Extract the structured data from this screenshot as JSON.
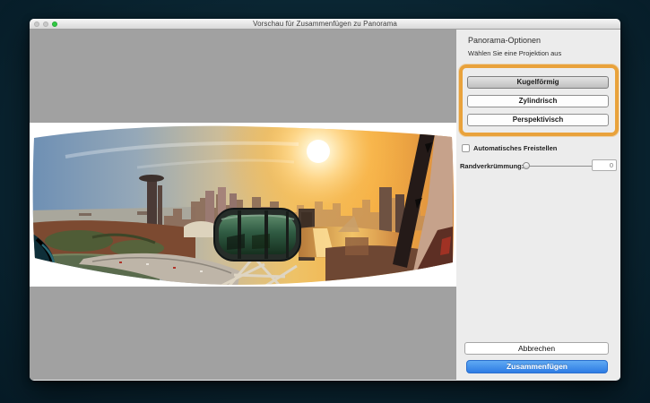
{
  "window": {
    "title": "Vorschau für Zusammenfügen zu Panorama",
    "traffic_lights": {
      "close": "inactive",
      "minimize": "inactive",
      "zoom": "green"
    },
    "traffic_green": "#30ca43"
  },
  "preview": {
    "canvas_color": "#A1A1A1",
    "band_color": "#FFFFFF"
  },
  "panel": {
    "title": "Panorama-Optionen",
    "subtitle": "Wählen Sie eine Projektion aus",
    "highlight_color": "#E9A23B",
    "projections": [
      {
        "label": "Kugelförmig",
        "selected": true
      },
      {
        "label": "Zylindrisch",
        "selected": false
      },
      {
        "label": "Perspektivisch",
        "selected": false
      }
    ],
    "auto_crop": {
      "label": "Automatisches Freistellen",
      "checked": false
    },
    "edge_warp": {
      "label": "Randverkrümmung:",
      "value": "0",
      "slider_position": "0%"
    },
    "cancel_label": "Abbrechen",
    "merge_label": "Zusammenfügen",
    "merge_color": "#3B85E9"
  }
}
